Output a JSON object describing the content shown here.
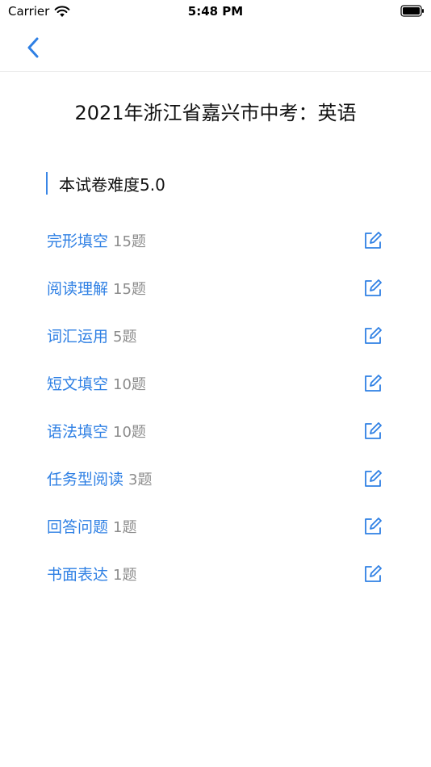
{
  "status_bar": {
    "carrier": "Carrier",
    "time": "5:48 PM"
  },
  "header": {
    "title": "2021年浙江省嘉兴市中考：英语"
  },
  "difficulty": {
    "label": "本试卷难度5.0"
  },
  "sections": [
    {
      "name": "完形填空",
      "count": "15题"
    },
    {
      "name": "阅读理解",
      "count": "15题"
    },
    {
      "name": "词汇运用",
      "count": "5题"
    },
    {
      "name": "短文填空",
      "count": "10题"
    },
    {
      "name": "语法填空",
      "count": "10题"
    },
    {
      "name": "任务型阅读",
      "count": "3题"
    },
    {
      "name": "回答问题",
      "count": "1题"
    },
    {
      "name": "书面表达",
      "count": "1题"
    }
  ],
  "colors": {
    "accent": "#2f80e4",
    "count_gray": "#8c8c8c",
    "divider": "#ececec"
  },
  "icons": {
    "back": "chevron-left-icon",
    "edit": "edit-icon"
  }
}
